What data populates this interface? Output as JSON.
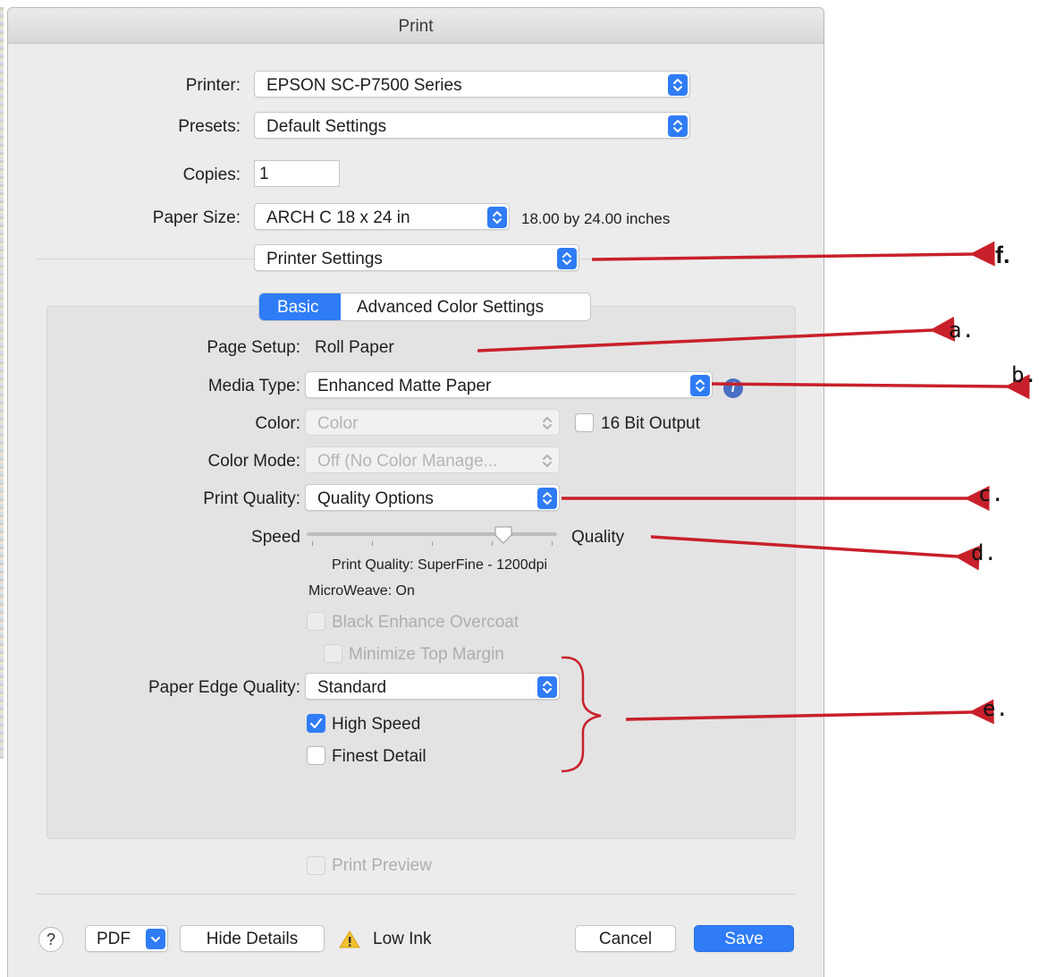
{
  "window": {
    "title": "Print"
  },
  "printer": {
    "label": "Printer:",
    "value": "EPSON SC-P7500 Series"
  },
  "presets": {
    "label": "Presets:",
    "value": "Default Settings"
  },
  "copies": {
    "label": "Copies:",
    "value": "1"
  },
  "paper_size": {
    "label": "Paper Size:",
    "value": "ARCH C 18 x 24 in",
    "dimensions": "18.00 by 24.00 inches"
  },
  "section_menu": {
    "value": "Printer Settings"
  },
  "tabs": [
    {
      "label": "Basic",
      "selected": true
    },
    {
      "label": "Advanced Color Settings",
      "selected": false
    }
  ],
  "page_setup": {
    "label": "Page Setup:",
    "value": "Roll Paper"
  },
  "media_type": {
    "label": "Media Type:",
    "value": "Enhanced Matte Paper"
  },
  "color": {
    "label": "Color:",
    "value": "Color",
    "enabled": false
  },
  "bit16": {
    "label": "16 Bit Output",
    "checked": false
  },
  "color_mode": {
    "label": "Color Mode:",
    "value": "Off (No Color Manage...",
    "enabled": false
  },
  "print_quality": {
    "label": "Print Quality:",
    "value": "Quality Options"
  },
  "speed_slider": {
    "left_label": "Speed",
    "right_label": "Quality",
    "level": 0.8
  },
  "quality_info": {
    "print_quality": "Print Quality: SuperFine - 1200dpi",
    "microweave": "MicroWeave: On"
  },
  "black_enhance": {
    "label": "Black Enhance Overcoat",
    "checked": false,
    "enabled": false
  },
  "minimize_margin": {
    "label": "Minimize Top Margin",
    "checked": false,
    "enabled": false
  },
  "paper_edge": {
    "label": "Paper Edge Quality:",
    "value": "Standard"
  },
  "high_speed": {
    "label": "High Speed",
    "checked": true
  },
  "finest_detail": {
    "label": "Finest Detail",
    "checked": false
  },
  "print_preview": {
    "label": "Print Preview",
    "checked": false,
    "enabled": false
  },
  "footer": {
    "help": "?",
    "pdf": "PDF",
    "hide_details": "Hide Details",
    "low_ink": "Low Ink",
    "cancel": "Cancel",
    "save": "Save"
  },
  "annotations": {
    "a": "a.",
    "b": "b.",
    "c": "c.",
    "d": "d.",
    "e": "e.",
    "f": "f."
  },
  "colors": {
    "accent": "#2f7cf6",
    "arrow": "#c8202a",
    "warning": "#f2c230"
  }
}
